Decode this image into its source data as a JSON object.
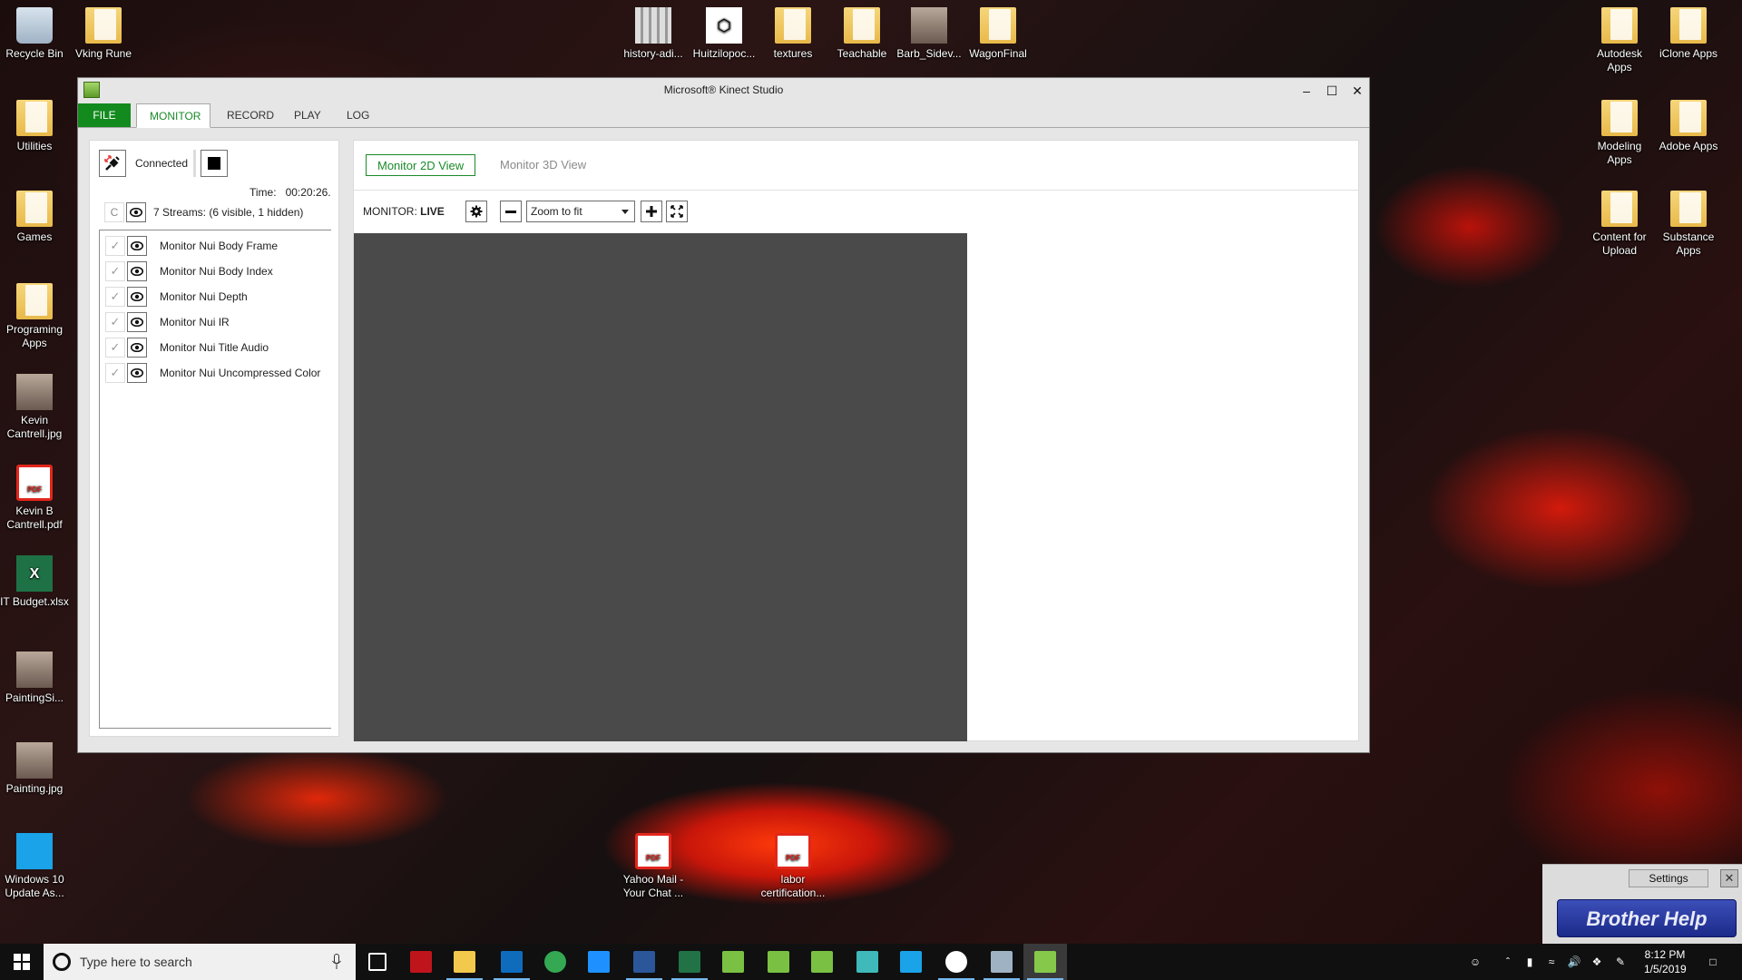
{
  "desktop": {
    "icons_left": [
      {
        "label": "Recycle Bin",
        "type": "bin"
      },
      {
        "label": "Vking Rune",
        "type": "folder"
      },
      {
        "label": "Utilities",
        "type": "folder"
      },
      {
        "label": "Games",
        "type": "folder"
      },
      {
        "label": "Programing Apps",
        "type": "folder"
      },
      {
        "label": "Kevin Cantrell.jpg",
        "type": "photo"
      },
      {
        "label": "Kevin B Cantrell.pdf",
        "type": "pdf"
      },
      {
        "label": "IT Budget.xlsx",
        "type": "xls"
      },
      {
        "label": "PaintingSi...",
        "type": "photo"
      },
      {
        "label": "Painting.jpg",
        "type": "photo"
      },
      {
        "label": "Windows 10 Update As...",
        "type": "win"
      }
    ],
    "icons_top": [
      {
        "label": "history-adi...",
        "type": "thumb"
      },
      {
        "label": "Huitzilopoc...",
        "type": "doc"
      },
      {
        "label": "textures",
        "type": "folder"
      },
      {
        "label": "Teachable",
        "type": "folder"
      },
      {
        "label": "Barb_Sidev...",
        "type": "photo"
      },
      {
        "label": "WagonFinal",
        "type": "folder"
      }
    ],
    "icons_right": [
      {
        "label": "Autodesk Apps",
        "type": "folder"
      },
      {
        "label": "iClone Apps",
        "type": "folder"
      },
      {
        "label": "Modeling Apps",
        "type": "folder"
      },
      {
        "label": "Adobe Apps",
        "type": "folder"
      },
      {
        "label": "Content for Upload",
        "type": "folder"
      },
      {
        "label": "Substance Apps",
        "type": "folder"
      }
    ],
    "icons_bottom": [
      {
        "label": "Yahoo Mail - Your Chat ...",
        "type": "pdf"
      },
      {
        "label": "labor certification...",
        "type": "pdf"
      }
    ]
  },
  "window": {
    "title": "Microsoft® Kinect Studio",
    "controls": {
      "minimize": "–",
      "maximize": "☐",
      "close": "✕"
    },
    "menu": [
      {
        "label": "FILE"
      },
      {
        "label": "MONITOR",
        "active": true
      },
      {
        "label": "RECORD"
      },
      {
        "label": "PLAY"
      },
      {
        "label": "LOG"
      }
    ],
    "left_panel": {
      "connection_status": "Connected",
      "time_label": "Time:",
      "time_value": "00:20:26.",
      "c_button": "C",
      "streams_summary": "7 Streams: (6 visible, 1 hidden)",
      "streams": [
        {
          "name": "Monitor Nui Body Frame",
          "checked": true,
          "visible": true
        },
        {
          "name": "Monitor Nui Body Index",
          "checked": true,
          "visible": true
        },
        {
          "name": "Monitor Nui Depth",
          "checked": true,
          "visible": true
        },
        {
          "name": "Monitor Nui IR",
          "checked": true,
          "visible": true
        },
        {
          "name": "Monitor Nui Title Audio",
          "checked": true,
          "visible": true
        },
        {
          "name": "Monitor Nui Uncompressed Color",
          "checked": true,
          "visible": true
        }
      ]
    },
    "main_panel": {
      "tabs": [
        {
          "label": "Monitor 2D View",
          "active": true
        },
        {
          "label": "Monitor 3D View",
          "active": false
        }
      ],
      "monitor_label": "MONITOR:",
      "monitor_state": "LIVE",
      "zoom_value": "Zoom to fit"
    }
  },
  "brother_widget": {
    "settings_label": "Settings",
    "close_label": "✕",
    "help_label": "Brother Help"
  },
  "taskbar": {
    "search_placeholder": "Type here to search",
    "time": "8:12 PM",
    "date": "1/5/2019",
    "apps": [
      {
        "name": "task-view",
        "color": "#ffffff",
        "open": false
      },
      {
        "name": "red-app",
        "color": "#c0141c",
        "open": false
      },
      {
        "name": "file-explorer",
        "color": "#f2c94c",
        "open": true
      },
      {
        "name": "outlook",
        "color": "#0f6cbd",
        "open": true
      },
      {
        "name": "chrome",
        "color": "#34a853",
        "open": false
      },
      {
        "name": "internet-explorer",
        "color": "#1e90ff",
        "open": false
      },
      {
        "name": "word",
        "color": "#2b579a",
        "open": true
      },
      {
        "name": "excel",
        "color": "#217346",
        "open": true
      },
      {
        "name": "people-app",
        "color": "#7ac143",
        "open": false
      },
      {
        "name": "xsplit",
        "color": "#7ac143",
        "open": false
      },
      {
        "name": "target-app",
        "color": "#7ac143",
        "open": false
      },
      {
        "name": "3ds-max",
        "color": "#3fb9b9",
        "open": false
      },
      {
        "name": "blue-app",
        "color": "#1aa3e8",
        "open": false
      },
      {
        "name": "w-app",
        "color": "#ffffff",
        "open": true
      },
      {
        "name": "settings",
        "color": "#9fb2c4",
        "open": true
      },
      {
        "name": "kinect-studio",
        "color": "#86c84a",
        "open": true
      }
    ]
  }
}
